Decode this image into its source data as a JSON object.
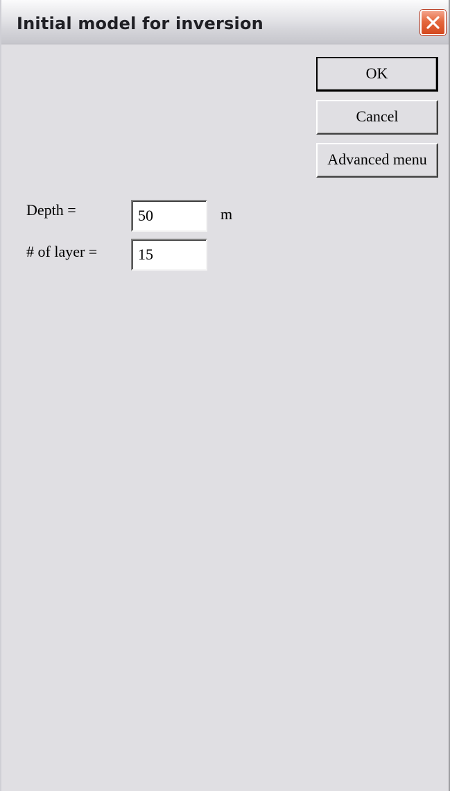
{
  "window": {
    "title": "Initial model for inversion"
  },
  "buttons": {
    "ok_label": "OK",
    "cancel_label": "Cancel",
    "advanced_label": "Advanced menu"
  },
  "form": {
    "depth_label": "Depth =",
    "depth_value": "50",
    "depth_unit": "m",
    "layers_label": "# of layer =",
    "layers_value": "15"
  },
  "icons": {
    "close": "close-icon"
  },
  "colors": {
    "dialog_bg": "#e0dfe3",
    "close_button": "#e5683e"
  }
}
